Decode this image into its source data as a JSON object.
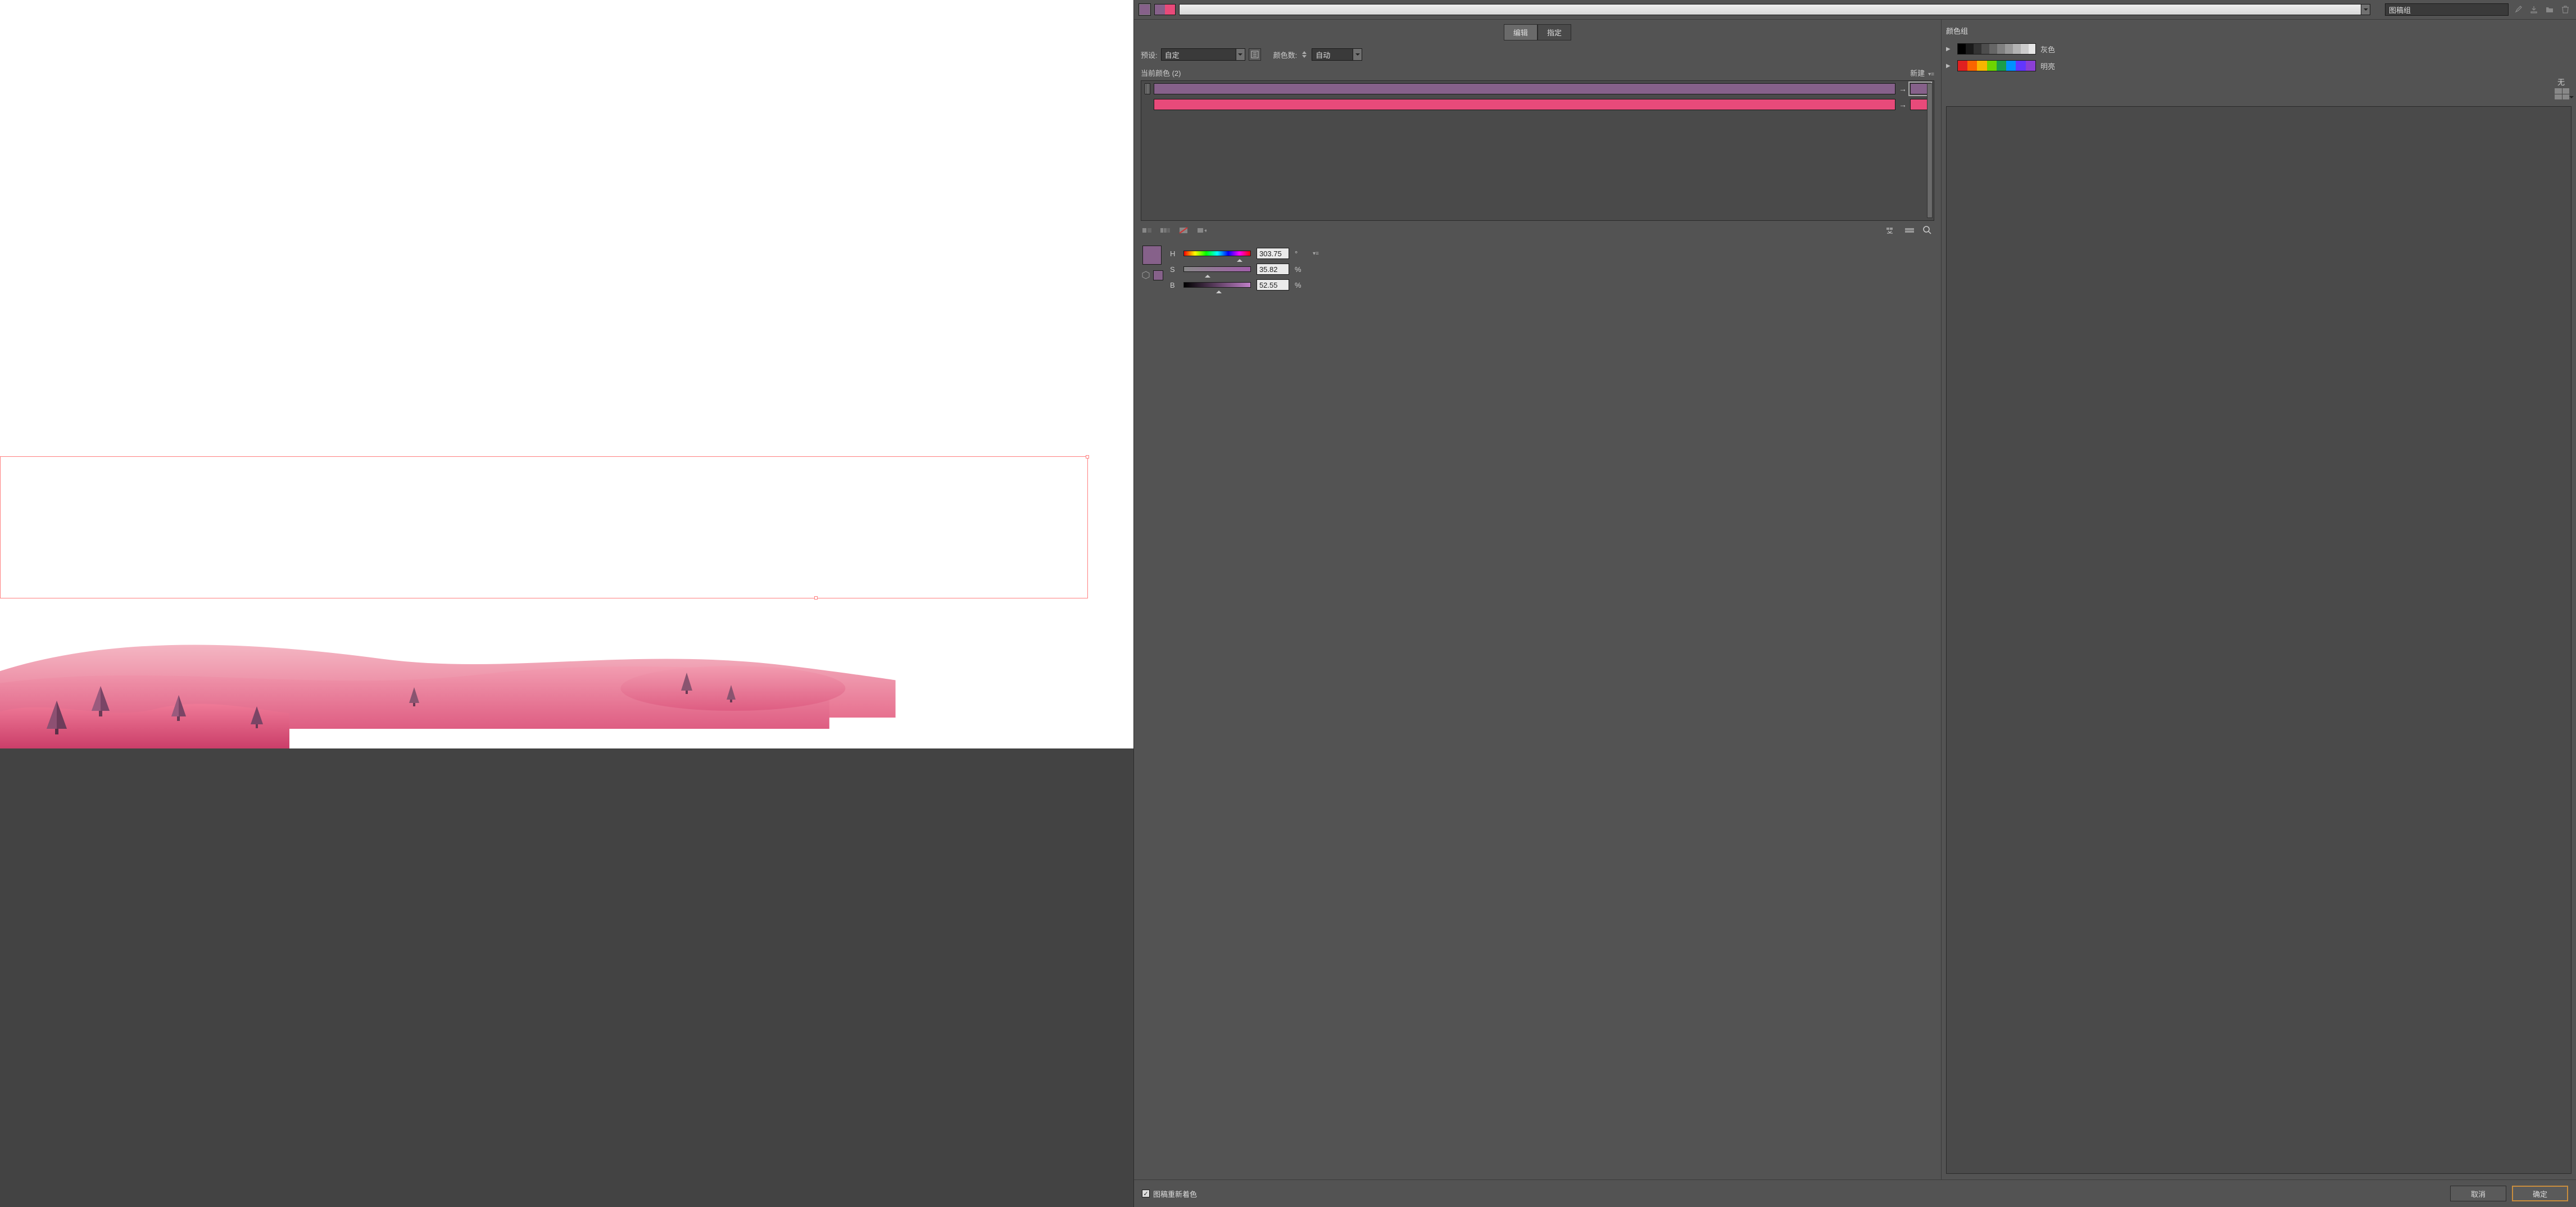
{
  "topbar": {
    "active_swatch": "#86618a",
    "duo": [
      "#86618a",
      "#e84a7a"
    ],
    "group_name": "图稿组"
  },
  "tabs": {
    "edit": "编辑",
    "assign": "指定",
    "active": "assign"
  },
  "preset": {
    "label": "预设:",
    "value": "自定",
    "colors_label": "颜色数:",
    "colors_value": "自动"
  },
  "current": {
    "label": "当前颜色 (2)",
    "new_label": "新建",
    "rows": [
      {
        "from": "#86618a",
        "to": "#86618a",
        "selected": true
      },
      {
        "from": "#e84a7a",
        "to": "#e84a7a",
        "selected": false
      }
    ]
  },
  "hsb": {
    "H": {
      "label": "H",
      "value": "303.75",
      "unit": "°"
    },
    "S": {
      "label": "S",
      "value": "35.82",
      "unit": "%"
    },
    "B": {
      "label": "B",
      "value": "52.55",
      "unit": "%"
    },
    "swatch_main": "#86618a",
    "swatch_small": "#86618a"
  },
  "none_label": "无",
  "recolor": {
    "label": "图稿重新着色",
    "checked": true
  },
  "buttons": {
    "cancel": "取消",
    "ok": "确定"
  },
  "colorgroups": {
    "title": "颜色组",
    "items": [
      {
        "name": "灰色",
        "type": "gray"
      },
      {
        "name": "明亮",
        "type": "rainbow",
        "colors": [
          "#e02020",
          "#fa6400",
          "#f7b500",
          "#6dd400",
          "#1a9e4b",
          "#0091ff",
          "#6236ff",
          "#b620e0"
        ]
      }
    ]
  }
}
